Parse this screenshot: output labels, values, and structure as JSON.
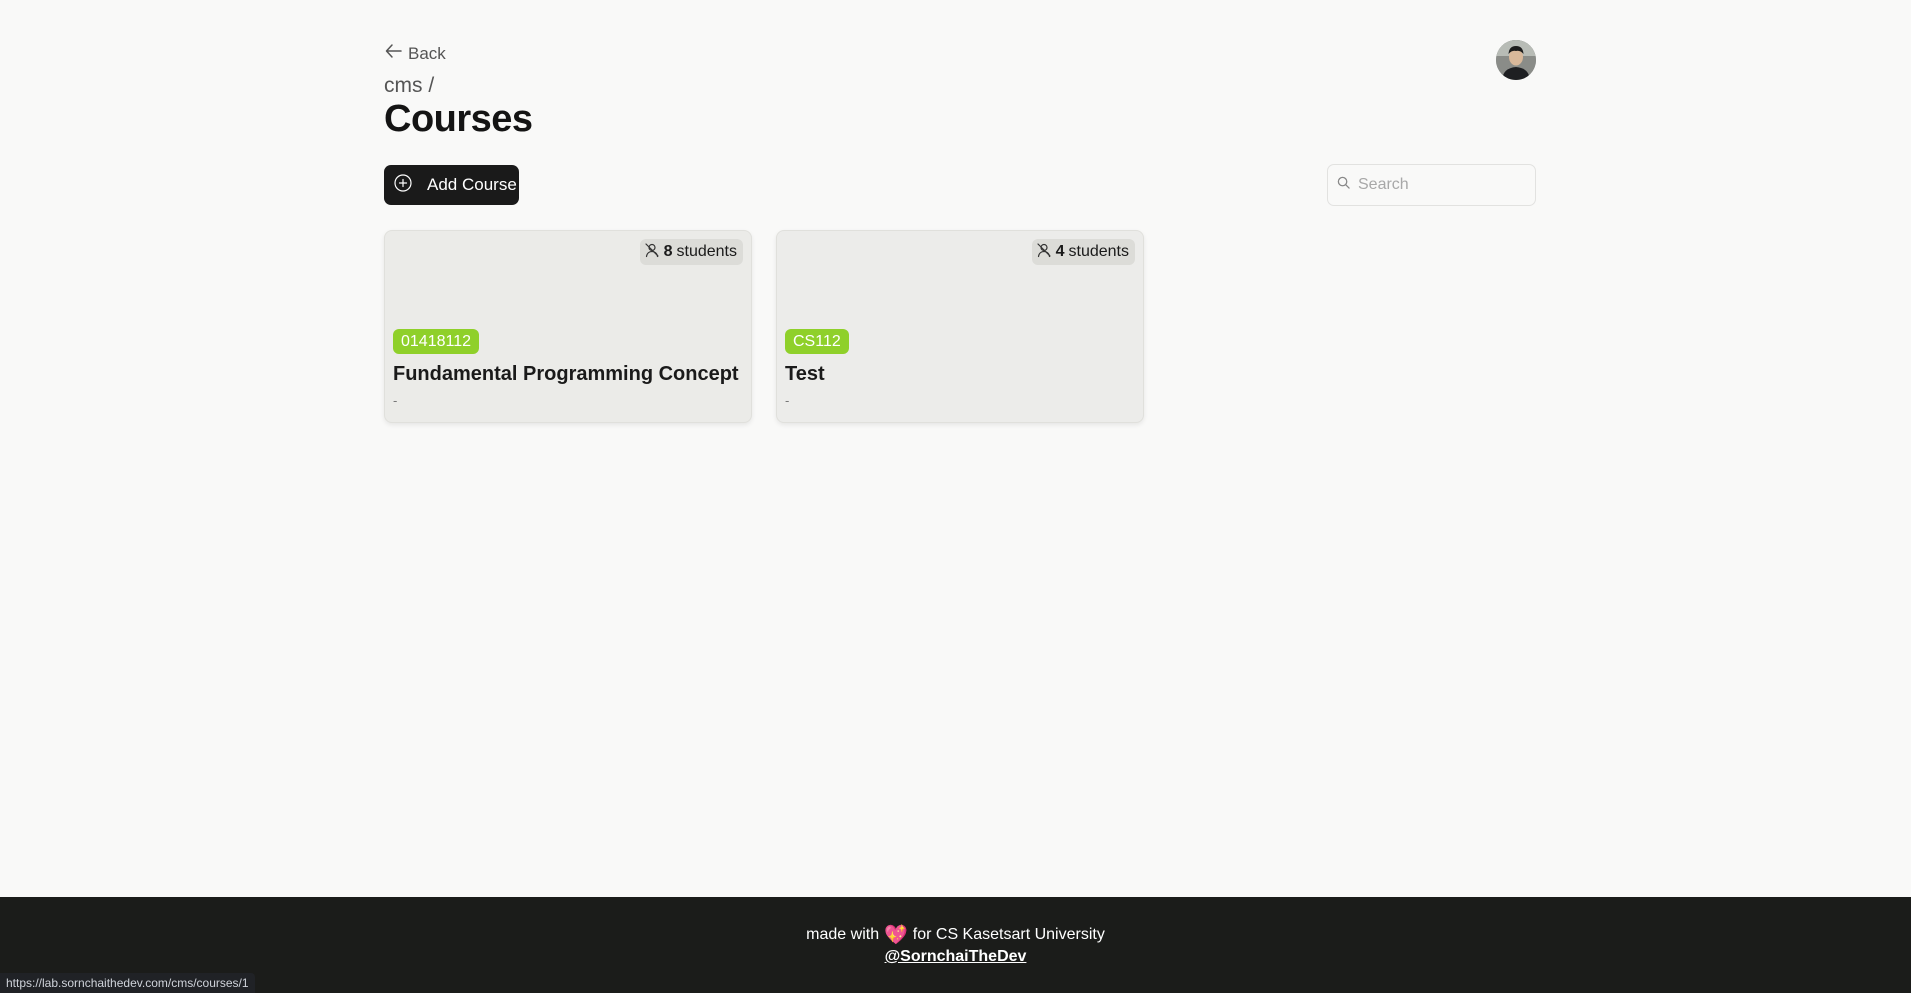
{
  "nav": {
    "back_label": "Back"
  },
  "breadcrumb": "cms /",
  "page_title": "Courses",
  "toolbar": {
    "add_course_label": "Add Course",
    "search_placeholder": "Search",
    "search_value": ""
  },
  "courses": [
    {
      "students_count": "8",
      "students_label": "students",
      "code": "01418112",
      "name": "Fundamental Programming Concept",
      "description": "-"
    },
    {
      "students_count": "4",
      "students_label": "students",
      "code": "CS112",
      "name": "Test",
      "description": "-"
    }
  ],
  "footer": {
    "made_with": "made with",
    "for_text": "for CS Kasetsart University",
    "handle": "@SornchaiTheDev"
  },
  "status_bar_url": "https://lab.sornchaithedev.com/cms/courses/1",
  "colors": {
    "accent_green": "#8fd02a",
    "button_dark": "#1a1a1a",
    "footer_bg": "#1b1c1a",
    "page_bg": "#f9f9f8"
  },
  "icons": [
    "arrow-left-icon",
    "plus-circle-icon",
    "search-icon",
    "user-icon",
    "heart-icon"
  ]
}
